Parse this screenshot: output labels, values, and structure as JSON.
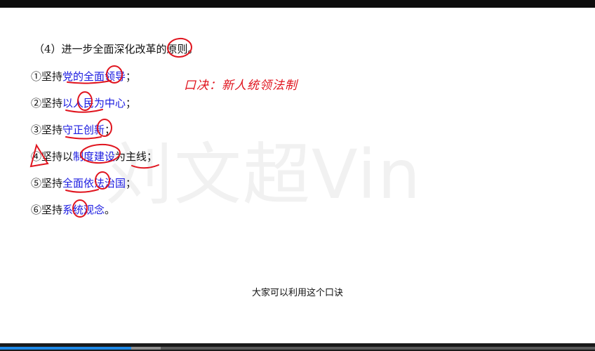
{
  "slide": {
    "watermark": "刘文超Vin",
    "heading": "（4）进一步全面深化改革的原则。",
    "items": [
      {
        "num": "①",
        "pre": "坚持",
        "kw": "党的全面领导",
        "post": "；"
      },
      {
        "num": "②",
        "pre": "坚持",
        "kw": "以人民为中心",
        "post": "；"
      },
      {
        "num": "③",
        "pre": "坚持",
        "kw": "守正创新",
        "post": "；"
      },
      {
        "num": "④",
        "pre": "坚持以",
        "kw": "制度建设",
        "post": "为主线；"
      },
      {
        "num": "⑤",
        "pre": "坚持",
        "kw": "全面依法治国",
        "post": "；"
      },
      {
        "num": "⑥",
        "pre": "坚持",
        "kw": "系统观念",
        "post": "。"
      }
    ],
    "mnemonic": "口决：新人统领法制"
  },
  "subtitle": "大家可以利用这个口诀",
  "player": {
    "progress_played": 0.22,
    "progress_buffered": 0.27
  },
  "colors": {
    "keyword": "#1a1ae0",
    "annotation": "#e0141e",
    "progress": "#1e88e5"
  }
}
